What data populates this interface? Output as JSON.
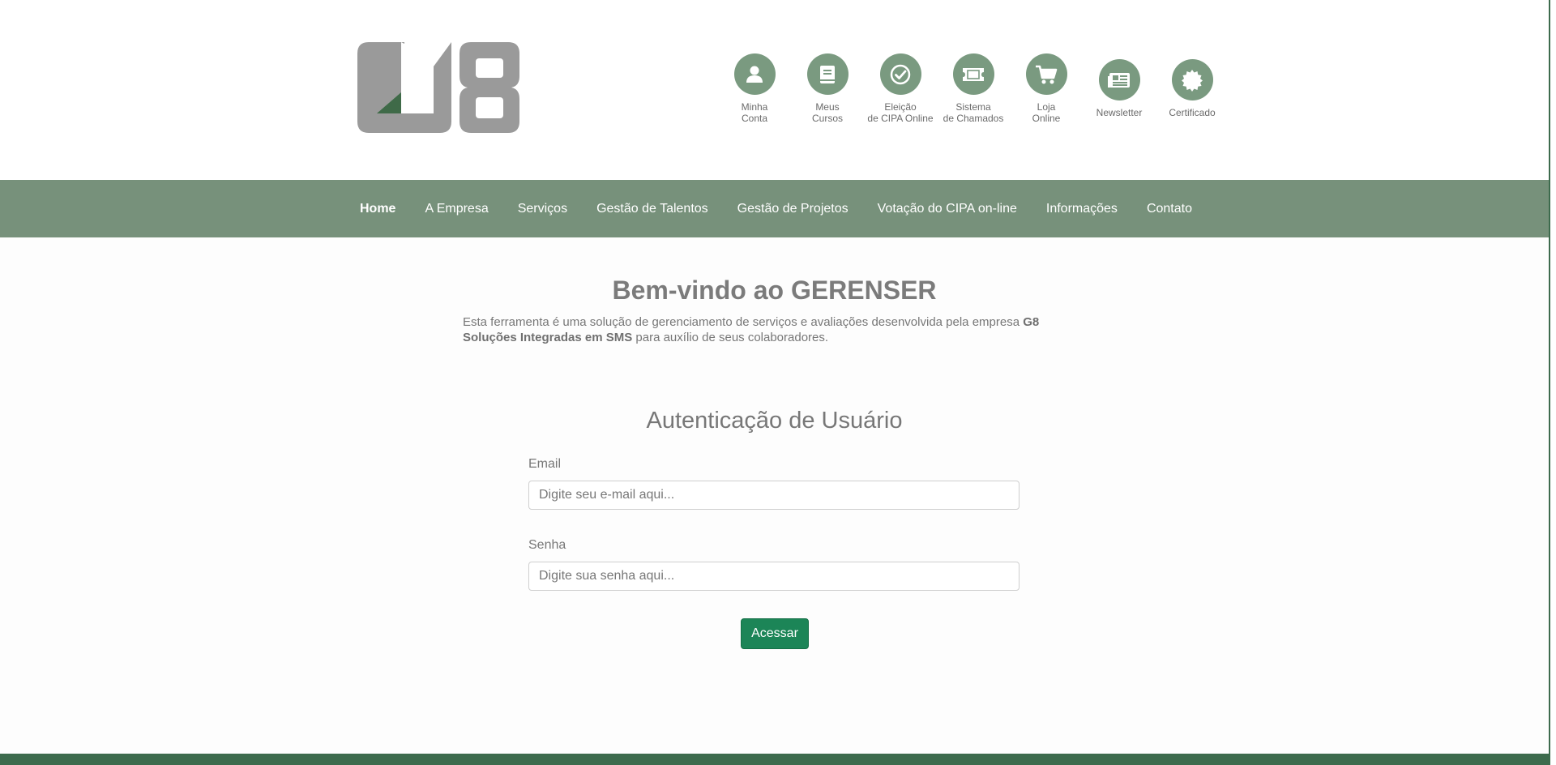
{
  "header": {
    "logo_alt": "G8",
    "quick_links": [
      {
        "label": "Minha\nConta",
        "icon": "user-icon"
      },
      {
        "label": "Meus\nCursos",
        "icon": "book-icon"
      },
      {
        "label": "Eleição\nde CIPA Online",
        "icon": "check-circle-icon"
      },
      {
        "label": "Sistema\nde Chamados",
        "icon": "ticket-icon"
      },
      {
        "label": "Loja\nOnline",
        "icon": "cart-icon"
      },
      {
        "label": "Newsletter",
        "icon": "newspaper-icon"
      },
      {
        "label": "Certificado",
        "icon": "certificate-icon"
      }
    ]
  },
  "nav": {
    "items": [
      {
        "label": "Home",
        "active": true
      },
      {
        "label": "A Empresa"
      },
      {
        "label": "Serviços"
      },
      {
        "label": "Gestão de Talentos"
      },
      {
        "label": "Gestão de Projetos"
      },
      {
        "label": "Votação do CIPA on-line"
      },
      {
        "label": "Informações"
      },
      {
        "label": "Contato"
      }
    ]
  },
  "main": {
    "title": "Bem-vindo ao GERENSER",
    "description_prefix": "Esta ferramenta é uma solução de gerenciamento de serviços e avaliações desenvolvida pela empresa ",
    "description_company": "G8 Soluções Integradas em SMS",
    "description_suffix": " para auxílio de seus colaboradores."
  },
  "auth": {
    "title": "Autenticação de Usuário",
    "email_label": "Email",
    "email_placeholder": "Digite seu e-mail aqui...",
    "email_value": "",
    "password_label": "Senha",
    "password_placeholder": "Digite sua senha aqui...",
    "password_value": "",
    "submit_label": "Acessar"
  },
  "colors": {
    "nav_bg": "#77917b",
    "icon_bg": "#7a9a80",
    "button_bg": "#1c8557",
    "footer_bg": "#3d6b4d",
    "logo_gray": "#9a9a9a",
    "logo_green": "#3f6a48"
  }
}
